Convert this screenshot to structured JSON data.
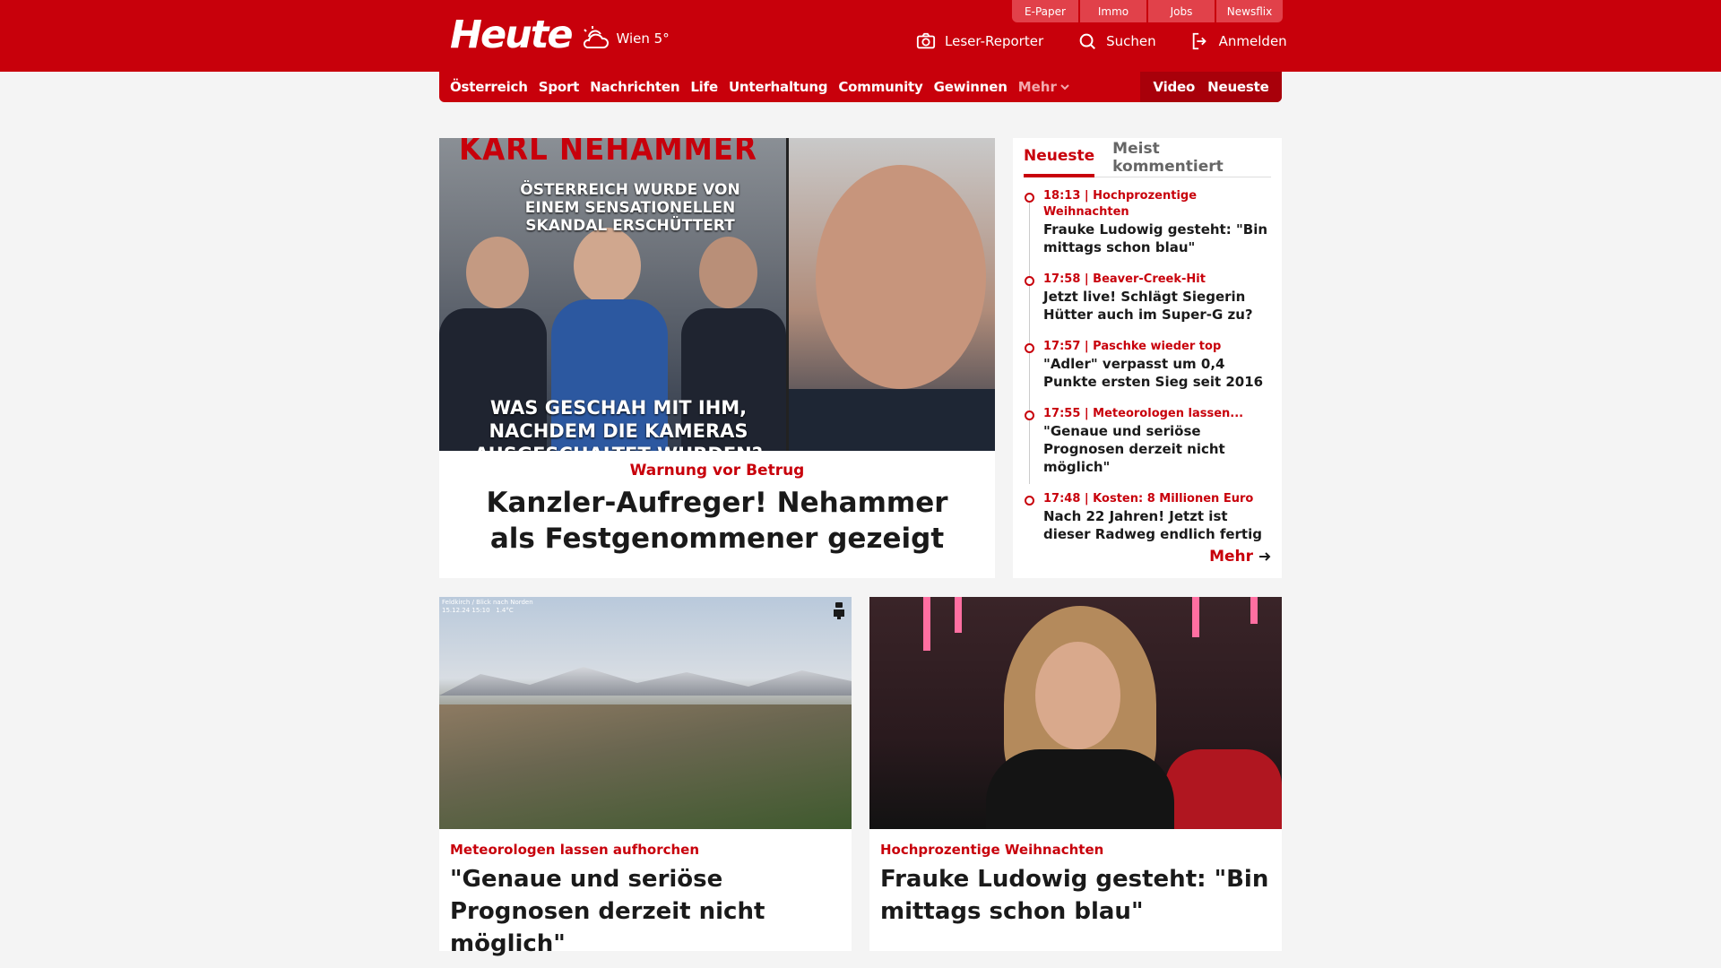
{
  "header": {
    "logo": "Heute",
    "weather": "Wien 5°",
    "utility_links": [
      "E-Paper",
      "Immo",
      "Jobs",
      "Newsflix"
    ],
    "actions": {
      "leser_reporter": "Leser-Reporter",
      "search": "Suchen",
      "login": "Anmelden"
    }
  },
  "nav": {
    "items": [
      "Österreich",
      "Sport",
      "Nachrichten",
      "Life",
      "Unterhaltung",
      "Community",
      "Gewinnen"
    ],
    "more": "Mehr",
    "video": "Video",
    "latest": "Neueste"
  },
  "hero": {
    "image_title": "KARL NEHAMMER",
    "image_sub1": "ÖSTERREICH WURDE VON EINEM SENSATIONELLEN SKANDAL ERSCHÜTTERT",
    "image_sub2": "WAS GESCHAH MIT IHM, NACHDEM DIE KAMERAS AUSGESCHALTET WURDEN?",
    "kicker": "Warnung vor Betrug",
    "headline": "Kanzler-Aufreger! Nehammer als Festgenommener gezeigt"
  },
  "sidebar": {
    "tabs": [
      "Neueste",
      "Meist kommentiert"
    ],
    "items": [
      {
        "meta": "18:13 | Hochprozentige Weihnachten",
        "title": "Frauke Ludowig gesteht: \"Bin mittags schon blau\""
      },
      {
        "meta": "17:58 | Beaver-Creek-Hit",
        "title": "Jetzt live! Schlägt Siegerin Hütter auch im Super-G zu?"
      },
      {
        "meta": "17:57 | Paschke wieder top",
        "title": "\"Adler\" verpasst um 0,4 Punkte ersten Sieg seit 2016"
      },
      {
        "meta": "17:55 | Meteorologen lassen...",
        "title": "\"Genaue und seriöse Prognosen derzeit nicht möglich\""
      },
      {
        "meta": "17:48 | Kosten: 8 Millionen Euro",
        "title": "Nach 22 Jahren! Jetzt ist dieser Radweg endlich fertig"
      }
    ],
    "more": "Mehr"
  },
  "cards": [
    {
      "cam_text": "Feldkirch / Blick nach Norden\n15.12.24 15:10   1.4°C",
      "kicker": "Meteorologen lassen aufhorchen",
      "headline": "\"Genaue und seriöse Prognosen derzeit nicht möglich\""
    },
    {
      "kicker": "Hochprozentige Weihnachten",
      "headline": "Frauke Ludowig gesteht: \"Bin mittags schon blau\""
    }
  ],
  "colors": {
    "brand_red": "#c8000b",
    "dark_red": "#a8000a",
    "utility_red": "#e1414a"
  }
}
